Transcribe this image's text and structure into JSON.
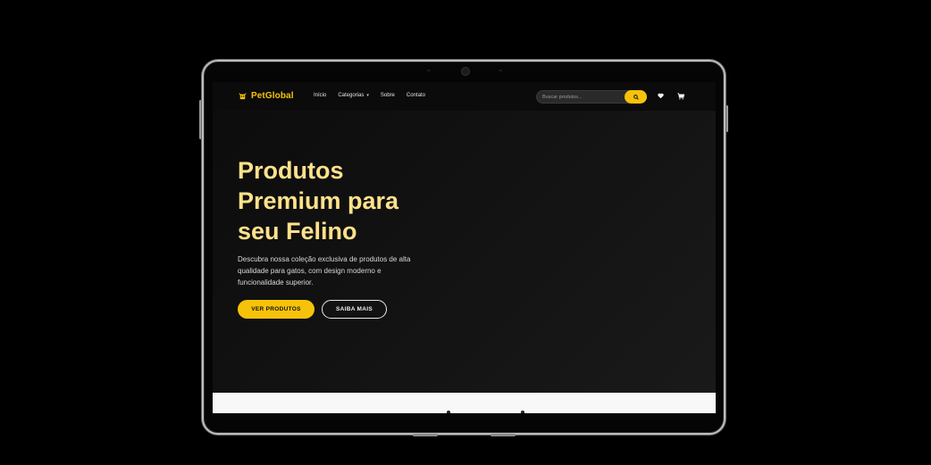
{
  "brand": {
    "name": "PetGlobal",
    "accent": "#f7c20a"
  },
  "nav": {
    "links": [
      "Início",
      "Categorias",
      "Sobre",
      "Contato"
    ],
    "search_placeholder": "Buscar produtos...",
    "icons": [
      "search-icon",
      "heart-icon",
      "cart-icon",
      "chevron-down-icon"
    ]
  },
  "hero": {
    "title_lines": [
      "Produtos",
      "Premium para",
      "seu Felino"
    ],
    "description_lines": [
      "Descubra nossa coleção exclusiva de produtos de alta",
      "qualidade para gatos, com design moderno e",
      "funcionalidade superior."
    ],
    "primary_button": "VER PRODUTOS",
    "secondary_button": "SAIBA MAIS"
  },
  "colors": {
    "title": "#ffe28a",
    "background": "#0c0c0c",
    "accent": "#f7c20a"
  }
}
